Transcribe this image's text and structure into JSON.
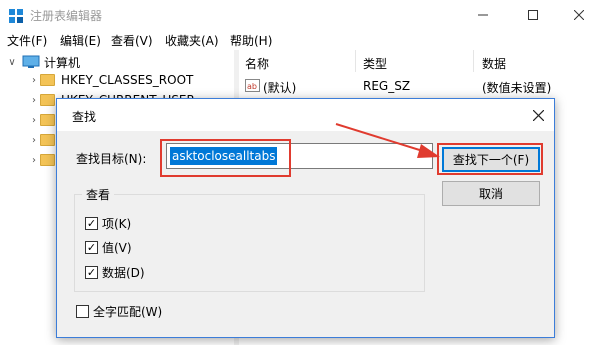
{
  "window": {
    "title": "注册表编辑器"
  },
  "menu": [
    "文件(F)",
    "编辑(E)",
    "查看(V)",
    "收藏夹(A)",
    "帮助(H)"
  ],
  "tree": {
    "root": "计算机",
    "keys": [
      "HKEY_CLASSES_ROOT",
      "HKEY_CURRENT_USER"
    ]
  },
  "list": {
    "headers": [
      "名称",
      "类型",
      "数据"
    ],
    "rows": [
      {
        "name": "(默认)",
        "type": "REG_SZ",
        "data": "(数值未设置)"
      }
    ]
  },
  "dialog": {
    "title": "查找",
    "find_label": "查找目标(N):",
    "find_value": "asktoclosealltabs",
    "find_next_label": "查找下一个(F)",
    "cancel_label": "取消",
    "look_at": {
      "title": "查看",
      "options": [
        {
          "label": "项(K)",
          "checked": true
        },
        {
          "label": "值(V)",
          "checked": true
        },
        {
          "label": "数据(D)",
          "checked": true
        }
      ]
    },
    "match_whole": {
      "label": "全字匹配(W)",
      "checked": false
    }
  },
  "colors": {
    "accent": "#0078d7",
    "annotation": "#e03b2f"
  }
}
